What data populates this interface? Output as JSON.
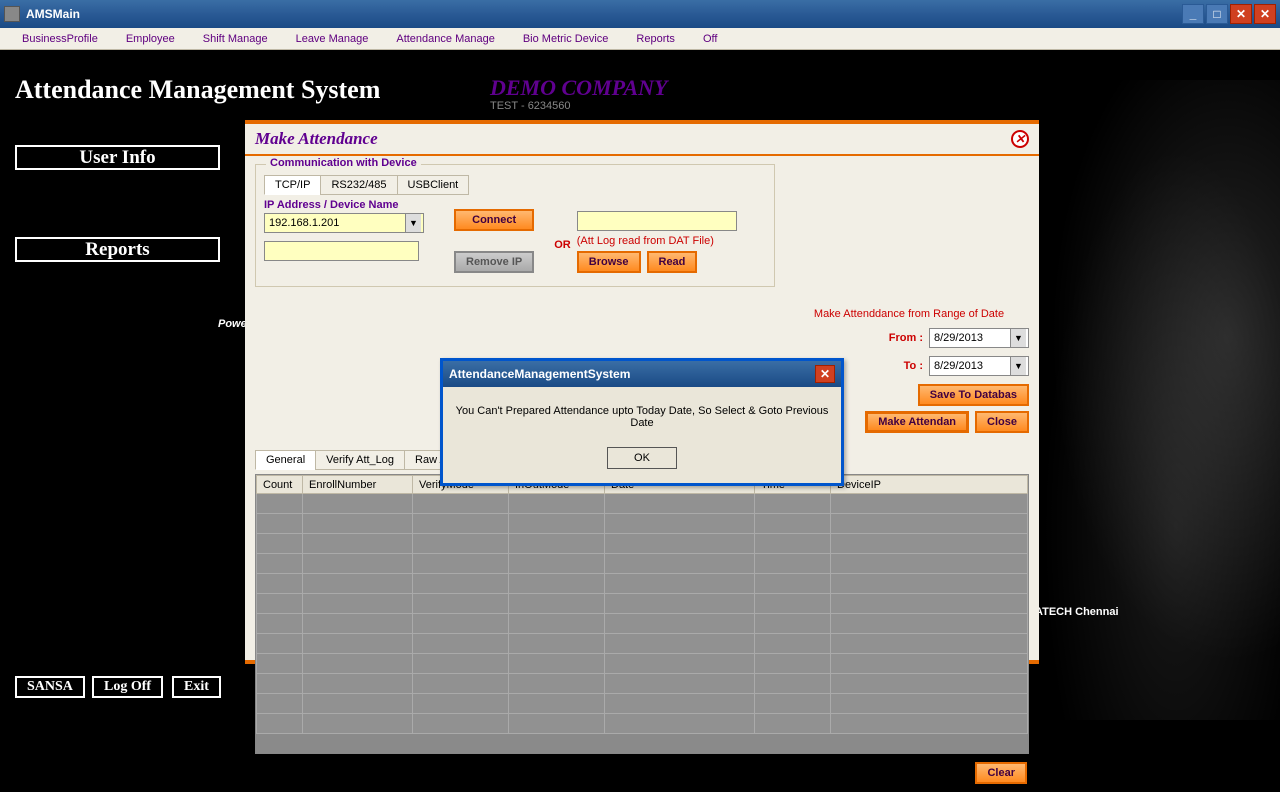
{
  "window": {
    "title": "AMSMain"
  },
  "menubar": [
    "BusinessProfile",
    "Employee",
    "Shift Manage",
    "Leave Manage",
    "Attendance Manage",
    "Bio Metric Device",
    "Reports",
    "Off"
  ],
  "header": {
    "title": "Attendance Management System",
    "company": "DEMO COMPANY",
    "company_sub": "TEST - 6234560",
    "powered": "Powere",
    "footer_right": "ATECH Chennai"
  },
  "sidebar": {
    "user_info": "User Info",
    "reports": "Reports"
  },
  "bottombar": {
    "sansa": "SANSA",
    "logoff": "Log Off",
    "exit": "Exit"
  },
  "panel": {
    "title": "Make Attendance",
    "group_legend": "Communication with Device",
    "comm_tabs": [
      "TCP/IP",
      "RS232/485",
      "USBClient"
    ],
    "ip_label": "IP Address / Device Name",
    "ip_value": "192.168.1.201",
    "connect": "Connect",
    "remove_ip": "Remove IP",
    "or": "OR",
    "dat_hint": "(Att Log read from DAT File)",
    "browse": "Browse",
    "read": "Read",
    "range_title": "Make Attenddance from Range of Date",
    "from_label": "From :",
    "to_label": "To :",
    "from_value": "8/29/2013",
    "to_value": "8/29/2013",
    "save_db": "Save To Databas",
    "make_att": "Make Attendan",
    "close": "Close",
    "data_tabs": [
      "General",
      "Verify Att_Log",
      "Raw Att_Log"
    ],
    "clear": "Clear"
  },
  "table": {
    "columns": [
      "Count",
      "EnrollNumber",
      "VerifyMode",
      "InOutMode",
      "Date",
      "Time",
      "DeviceIP"
    ]
  },
  "modal": {
    "title": "AttendanceManagementSystem",
    "message": "You Can't Prepared Attendance upto Today Date, So Select & Goto Previous Date",
    "ok": "OK"
  }
}
